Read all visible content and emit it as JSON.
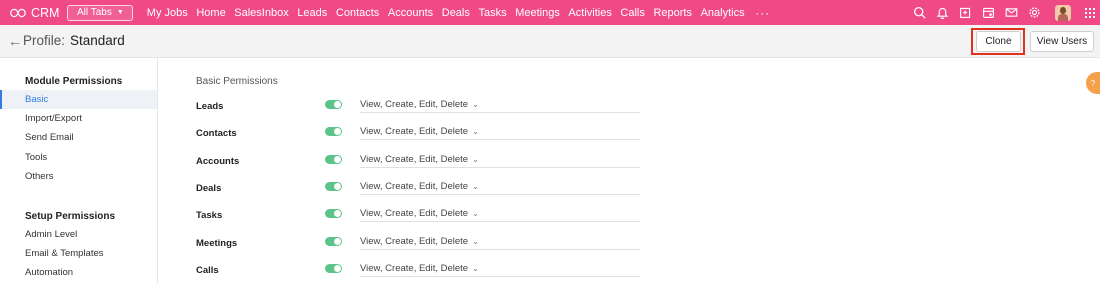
{
  "topbar": {
    "app_name": "CRM",
    "all_tabs_label": "All Tabs",
    "nav": [
      "My Jobs",
      "Home",
      "SalesInbox",
      "Leads",
      "Contacts",
      "Accounts",
      "Deals",
      "Tasks",
      "Meetings",
      "Activities",
      "Calls",
      "Reports",
      "Analytics"
    ],
    "more_label": "···",
    "icons": [
      "search-icon",
      "bell-icon",
      "add-note-icon",
      "calendar-icon",
      "mail-icon",
      "gear-icon",
      "avatar",
      "apps-grid-icon"
    ],
    "color": "#ef4a86"
  },
  "header": {
    "title_label": "Profile:",
    "title_value": "Standard",
    "clone_label": "Clone",
    "view_users_label": "View Users"
  },
  "sidebar": {
    "module_heading": "Module Permissions",
    "module_items": [
      "Basic",
      "Import/Export",
      "Send Email",
      "Tools",
      "Others"
    ],
    "active_item": "Basic",
    "setup_heading": "Setup Permissions",
    "setup_items": [
      "Admin Level",
      "Email & Templates",
      "Automation"
    ]
  },
  "main": {
    "title": "Basic Permissions",
    "permissions": [
      {
        "name": "Leads",
        "enabled": true,
        "value": "View, Create, Edit, Delete"
      },
      {
        "name": "Contacts",
        "enabled": true,
        "value": "View, Create, Edit, Delete"
      },
      {
        "name": "Accounts",
        "enabled": true,
        "value": "View, Create, Edit, Delete"
      },
      {
        "name": "Deals",
        "enabled": true,
        "value": "View, Create, Edit, Delete"
      },
      {
        "name": "Tasks",
        "enabled": true,
        "value": "View, Create, Edit, Delete"
      },
      {
        "name": "Meetings",
        "enabled": true,
        "value": "View, Create, Edit, Delete"
      },
      {
        "name": "Calls",
        "enabled": true,
        "value": "View, Create, Edit, Delete"
      }
    ]
  },
  "help_tab_label": "?"
}
